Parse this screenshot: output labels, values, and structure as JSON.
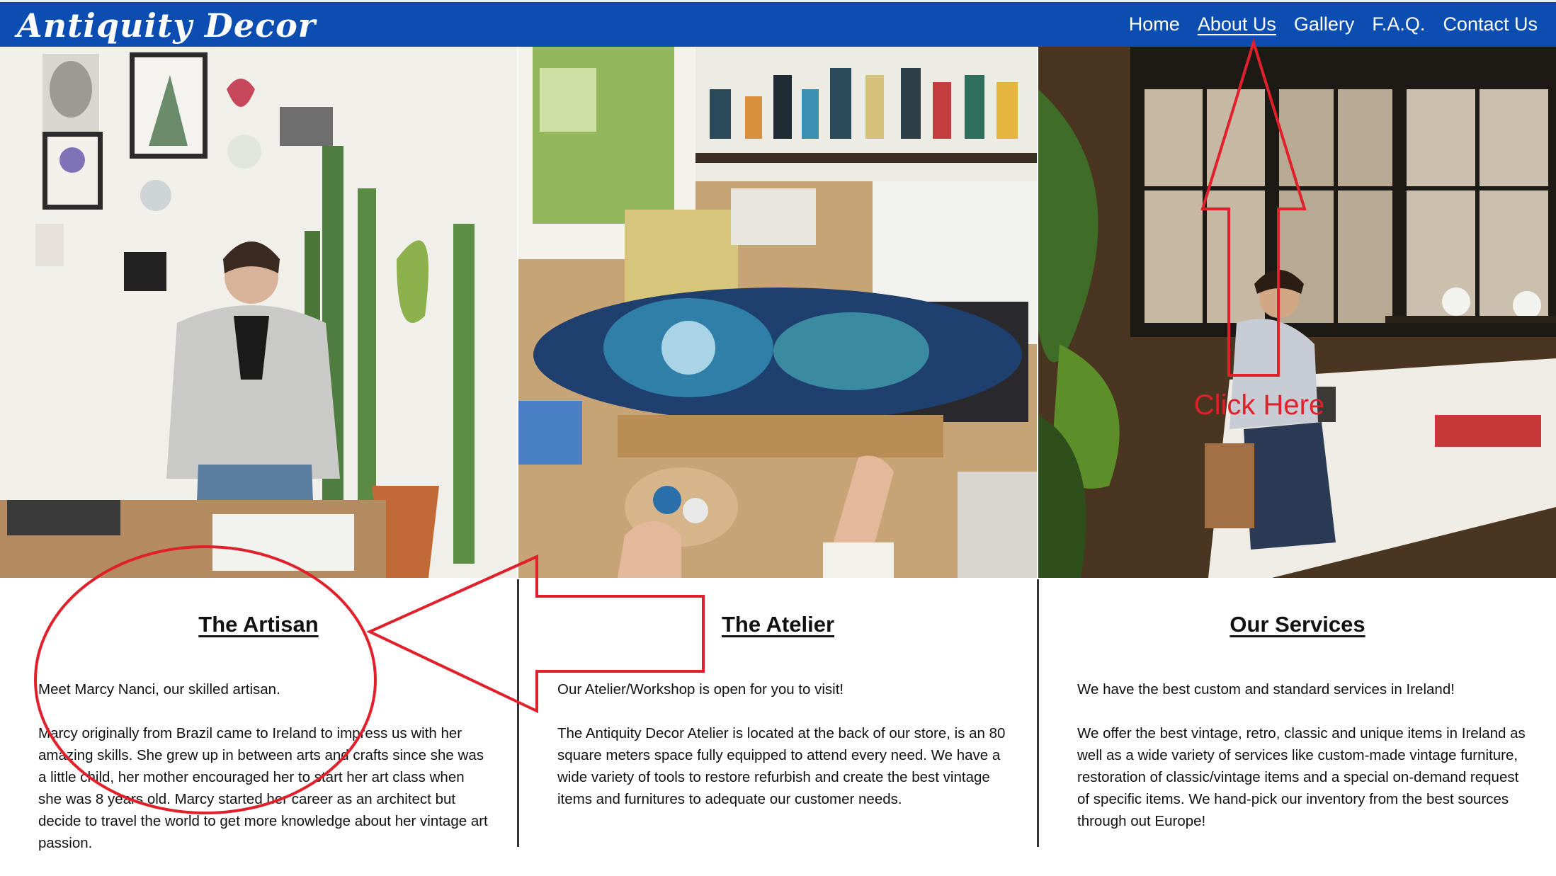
{
  "header": {
    "brand": "Antiquity Decor",
    "nav": [
      "Home",
      "About Us",
      "Gallery",
      "F.A.Q.",
      "Contact Us"
    ],
    "active_index": 1,
    "background_color": "#0b4db0"
  },
  "cards": [
    {
      "title": "The Artisan",
      "paragraphs": [
        "Meet Marcy Nanci, our skilled artisan.",
        "Marcy originally from Brazil came to Ireland to impress us with her amazing skills. She grew up in between arts and crafts since she was a little child, her mother encouraged her to start her art class when she was 8 years old. Marcy started her career as an architect but decide to travel the world to get more knowledge about her vintage art passion."
      ]
    },
    {
      "title": "The Atelier",
      "paragraphs": [
        "Our Atelier/Workshop is open for you to visit!",
        "The Antiquity Decor Atelier is located at the back of our store, is an 80 square meters space fully equipped to attend every need. We have a wide variety of tools to restore refurbish and create the best vintage items and furnitures to adequate our customer needs."
      ]
    },
    {
      "title": "Our Services",
      "paragraphs": [
        "We have the best custom and standard services in Ireland!",
        "We offer the best vintage, retro, classic and unique items in Ireland as well as a wide variety of services like custom-made vintage furniture, restoration of classic/vintage items and a special on-demand request of specific items. We hand-pick our inventory from the best sources through out Europe!"
      ]
    }
  ],
  "annotation": {
    "label": "Click Here",
    "color": "#e0202a"
  },
  "icons": [
    "artisan-photo",
    "atelier-photo",
    "workshop-photo"
  ]
}
